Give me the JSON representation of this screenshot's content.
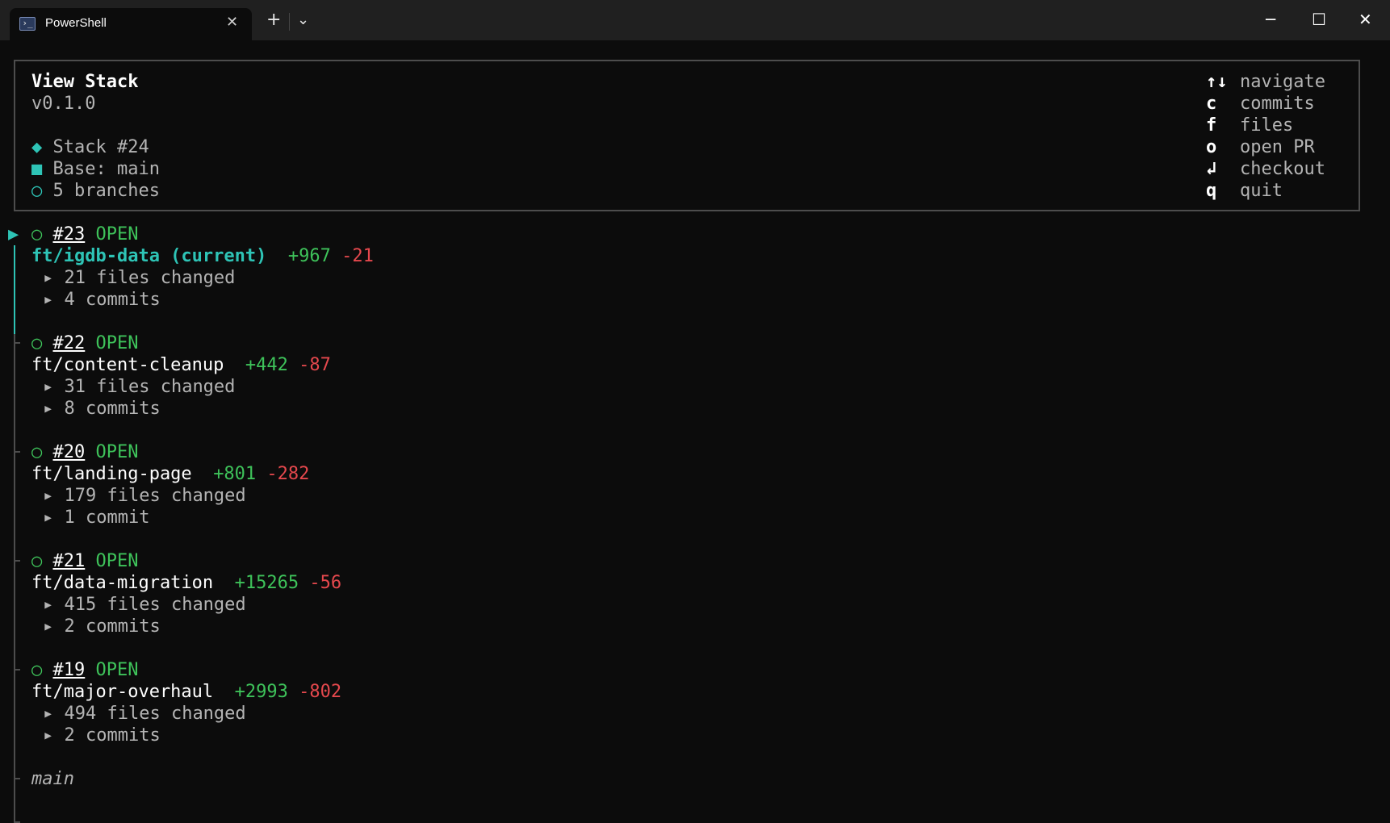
{
  "window": {
    "tab_title": "PowerShell",
    "tab_icon_glyph": "›_",
    "new_tab": "+",
    "dropdown": "⌄",
    "close_tab": "✕",
    "minimize": "─",
    "maximize": "☐",
    "close": "✕"
  },
  "header": {
    "title": "View Stack",
    "version": "v0.1.0",
    "stack": "Stack #24",
    "base": "Base: main",
    "branches": "5 branches",
    "stack_bullet": "◆",
    "base_bullet": "■",
    "branches_bullet": "○"
  },
  "keys": [
    {
      "key": "↑↓",
      "action": "navigate"
    },
    {
      "key": "c",
      "action": "commits"
    },
    {
      "key": "f",
      "action": "files"
    },
    {
      "key": "o",
      "action": "open PR"
    },
    {
      "key": "↲",
      "action": "checkout"
    },
    {
      "key": "q",
      "action": "quit"
    }
  ],
  "cursor": "▶",
  "prs": [
    {
      "number": "#23",
      "state": "OPEN",
      "branch": "ft/igdb-data (current)",
      "additions": "+967",
      "deletions": "-21",
      "files": "21 files changed",
      "commits": "4 commits"
    },
    {
      "number": "#22",
      "state": "OPEN",
      "branch": "ft/content-cleanup",
      "additions": "+442",
      "deletions": "-87",
      "files": "31 files changed",
      "commits": "8 commits"
    },
    {
      "number": "#20",
      "state": "OPEN",
      "branch": "ft/landing-page",
      "additions": "+801",
      "deletions": "-282",
      "files": "179 files changed",
      "commits": "1 commit"
    },
    {
      "number": "#21",
      "state": "OPEN",
      "branch": "ft/data-migration",
      "additions": "+15265",
      "deletions": "-56",
      "files": "415 files changed",
      "commits": "2 commits"
    },
    {
      "number": "#19",
      "state": "OPEN",
      "branch": "ft/major-overhaul",
      "additions": "+2993",
      "deletions": "-802",
      "files": "494 files changed",
      "commits": "2 commits"
    }
  ],
  "circle": "○",
  "expander": "▸",
  "base_branch": "main",
  "colors": {
    "accent": "#2ec4b6",
    "additions": "#3ec25a",
    "deletions": "#e5484d",
    "open_state": "#3ec25a"
  }
}
